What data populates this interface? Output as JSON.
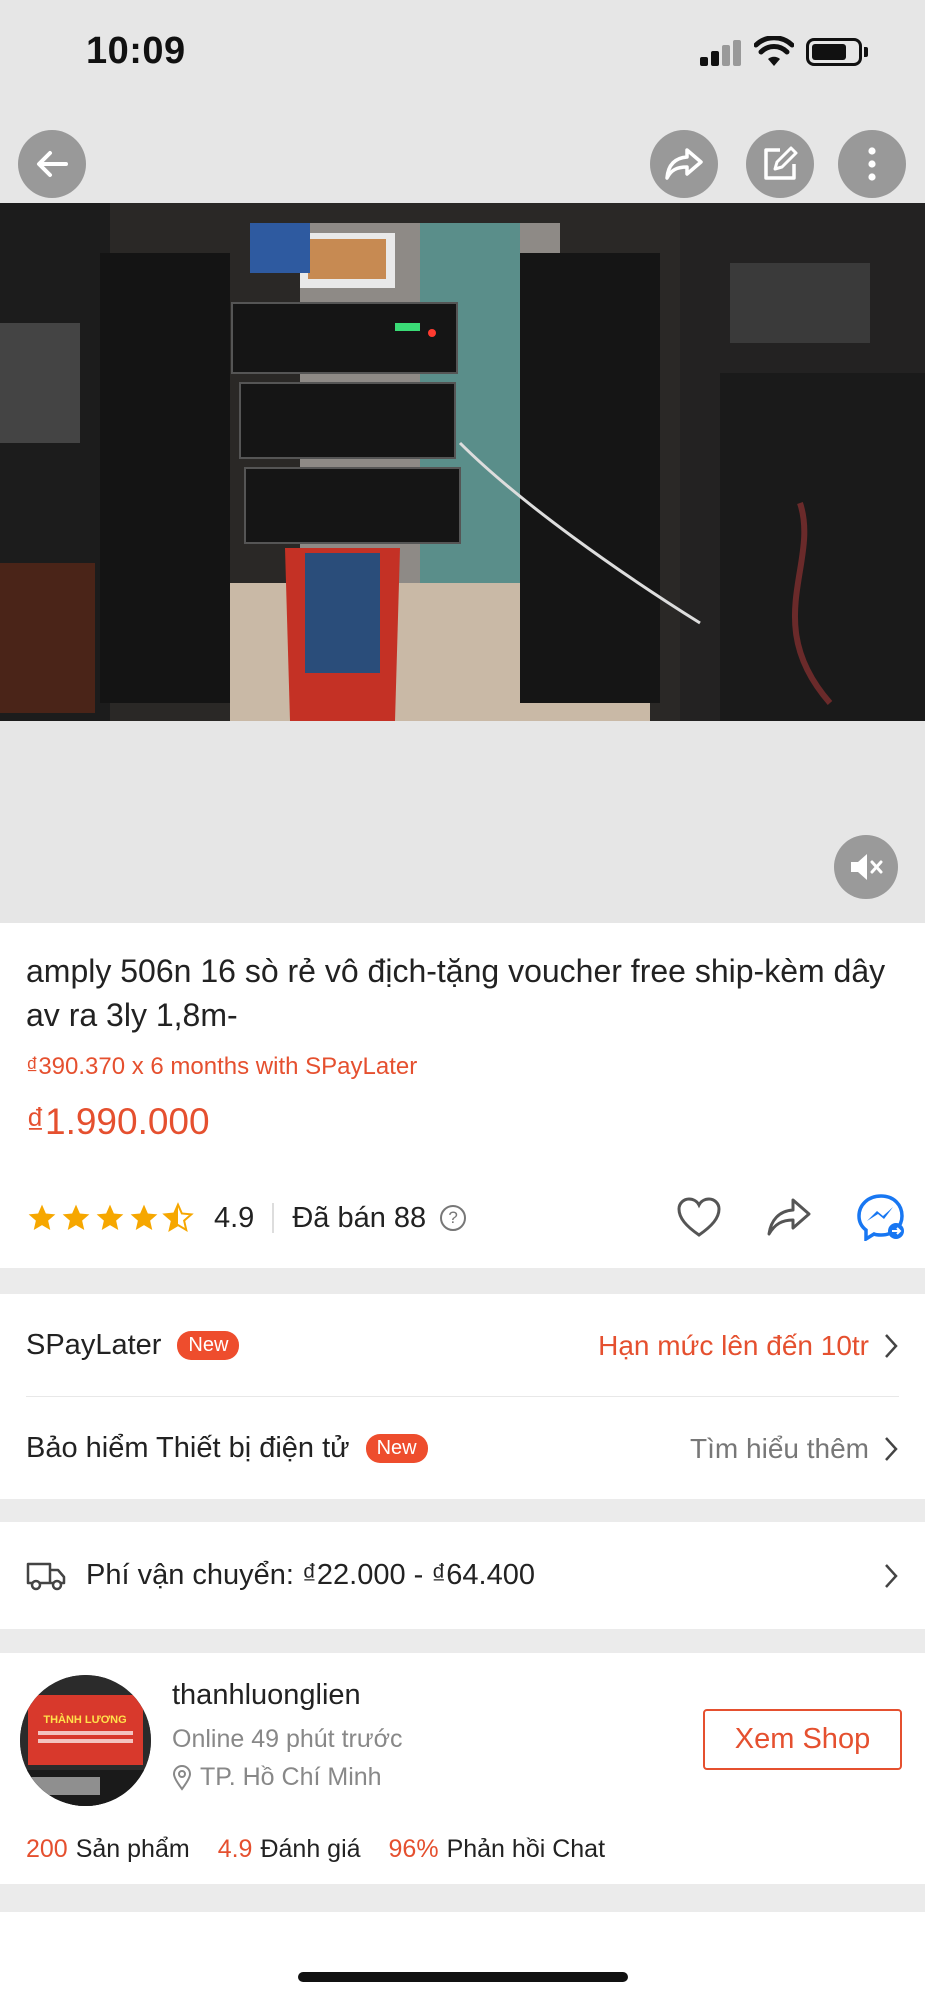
{
  "status_bar": {
    "time": "10:09"
  },
  "product": {
    "title": "amply 506n 16 sò rẻ vô địch-tặng voucher free ship-kèm dây av ra 3ly 1,8m-",
    "installment": "₫390.370 x 6 months with SPayLater",
    "price": "₫1.990.000",
    "rating": "4.9",
    "rating_stars": 4.5,
    "sold": "Đã bán 88",
    "help_glyph": "?"
  },
  "spaylater": {
    "label": "SPayLater",
    "badge": "New",
    "right_text": "Hạn mức lên đến 10tr"
  },
  "insurance": {
    "label": "Bảo hiểm Thiết bị điện tử",
    "badge": "New",
    "right_text": "Tìm hiểu thêm"
  },
  "shipping": {
    "label": "Phí vận chuyển: ₫22.000 - ₫64.400"
  },
  "shop": {
    "name": "thanhluonglien",
    "online": "Online 49 phút trước",
    "location": "TP. Hồ Chí Minh",
    "button": "Xem Shop",
    "avatar_text": "THÀNH LƯƠNG",
    "stats": [
      {
        "value": "200",
        "label": "Sản phẩm"
      },
      {
        "value": "4.9",
        "label": "Đánh giá"
      },
      {
        "value": "96%",
        "label": "Phản hồi Chat"
      }
    ]
  },
  "colors": {
    "accent": "#ee4d2d",
    "price": "#e5502f",
    "star": "#f6a700",
    "messenger": "#1877f2"
  },
  "icons": [
    "back-arrow-icon",
    "share-icon",
    "edit-icon",
    "more-icon",
    "mute-icon",
    "heart-icon",
    "messenger-icon",
    "truck-icon",
    "chevron-right-icon",
    "location-pin-icon"
  ]
}
